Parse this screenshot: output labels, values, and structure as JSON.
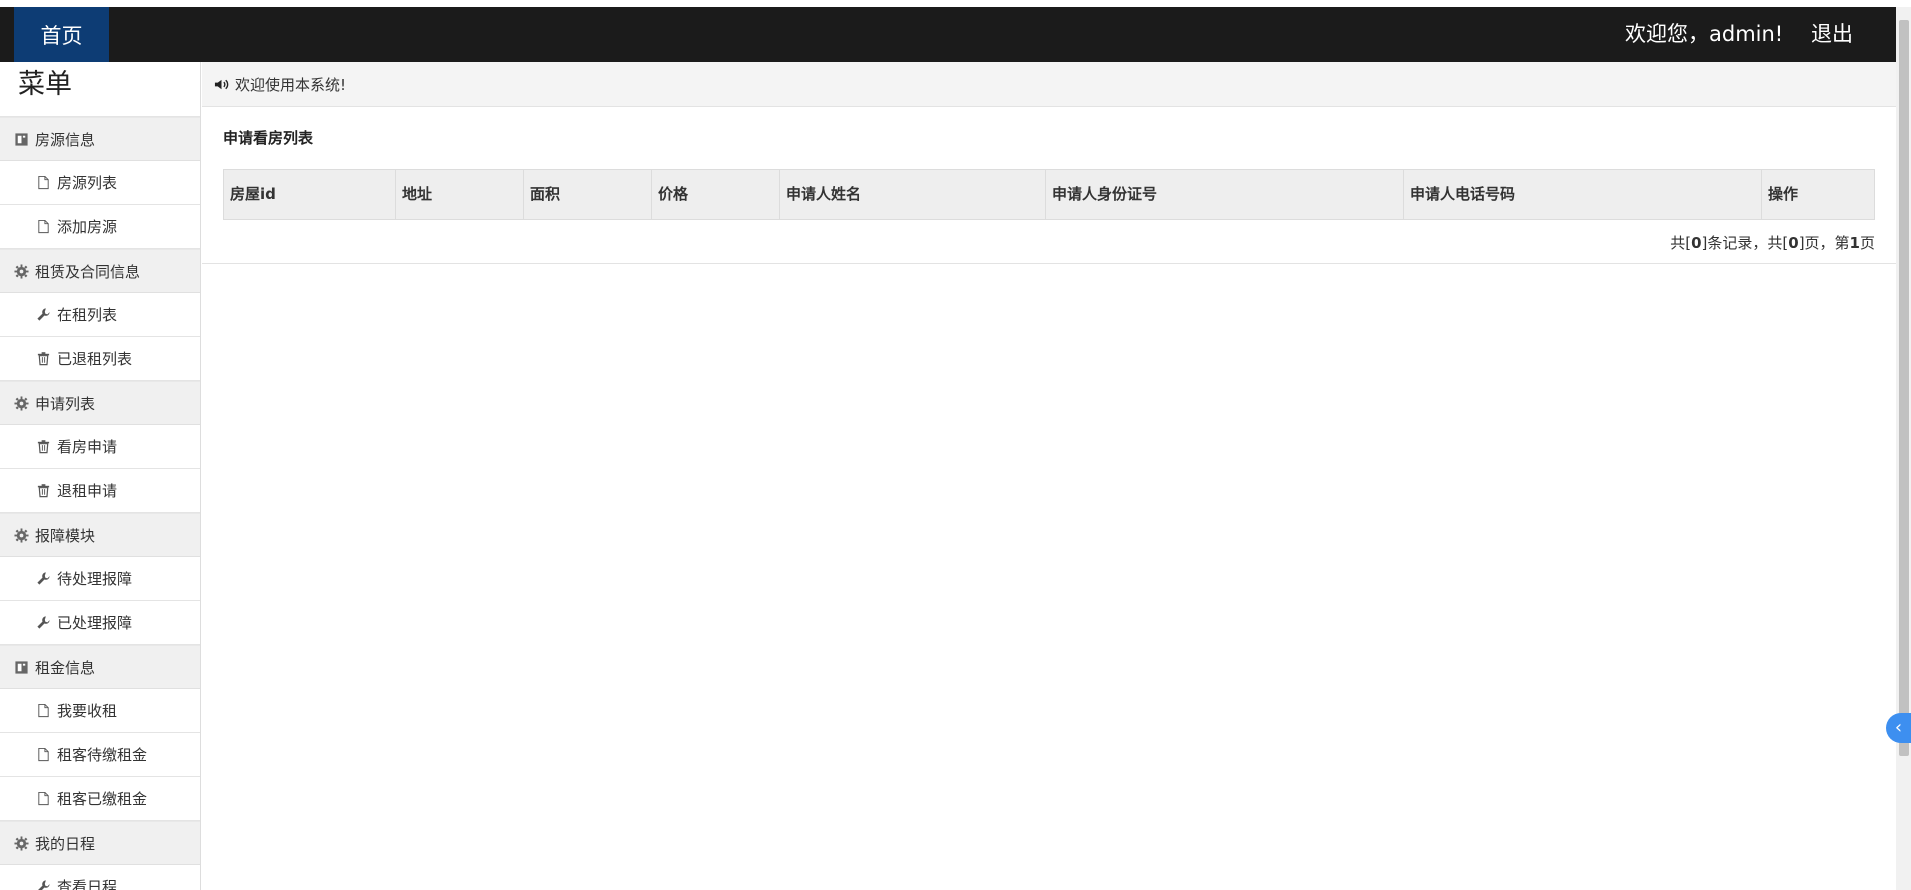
{
  "navbar": {
    "home_label": "首页",
    "welcome_text": "欢迎您，admin!",
    "logout_label": "退出"
  },
  "sidebar": {
    "menu_title": "菜单",
    "groups": [
      {
        "label": "房源信息",
        "icon": "book-icon",
        "items": [
          {
            "label": "房源列表",
            "icon": "file-icon"
          },
          {
            "label": "添加房源",
            "icon": "file-icon"
          }
        ]
      },
      {
        "label": "租赁及合同信息",
        "icon": "gear-icon",
        "items": [
          {
            "label": "在租列表",
            "icon": "wrench-icon"
          },
          {
            "label": "已退租列表",
            "icon": "trash-icon"
          }
        ]
      },
      {
        "label": "申请列表",
        "icon": "gear-icon",
        "items": [
          {
            "label": "看房申请",
            "icon": "trash-icon"
          },
          {
            "label": "退租申请",
            "icon": "trash-icon"
          }
        ]
      },
      {
        "label": "报障模块",
        "icon": "gear-icon",
        "items": [
          {
            "label": "待处理报障",
            "icon": "wrench-icon"
          },
          {
            "label": "已处理报障",
            "icon": "wrench-icon"
          }
        ]
      },
      {
        "label": "租金信息",
        "icon": "book-icon",
        "items": [
          {
            "label": "我要收租",
            "icon": "file-icon"
          },
          {
            "label": "租客待缴租金",
            "icon": "file-icon"
          },
          {
            "label": "租客已缴租金",
            "icon": "file-icon"
          }
        ]
      },
      {
        "label": "我的日程",
        "icon": "gear-icon",
        "items": [
          {
            "label": "查看日程",
            "icon": "wrench-icon"
          }
        ]
      }
    ]
  },
  "main": {
    "notice_text": "欢迎使用本系统!",
    "panel_title": "申请看房列表",
    "table": {
      "columns": [
        "房屋id",
        "地址",
        "面积",
        "价格",
        "申请人姓名",
        "申请人身份证号",
        "申请人电话号码",
        "操作"
      ]
    },
    "pager": {
      "prefix": "共[",
      "records": "0",
      "mid1": "]条记录，共[",
      "pages": "0",
      "mid2": "]页，第",
      "current": "1",
      "suffix": "页"
    }
  },
  "float_button_glyph": "‹"
}
